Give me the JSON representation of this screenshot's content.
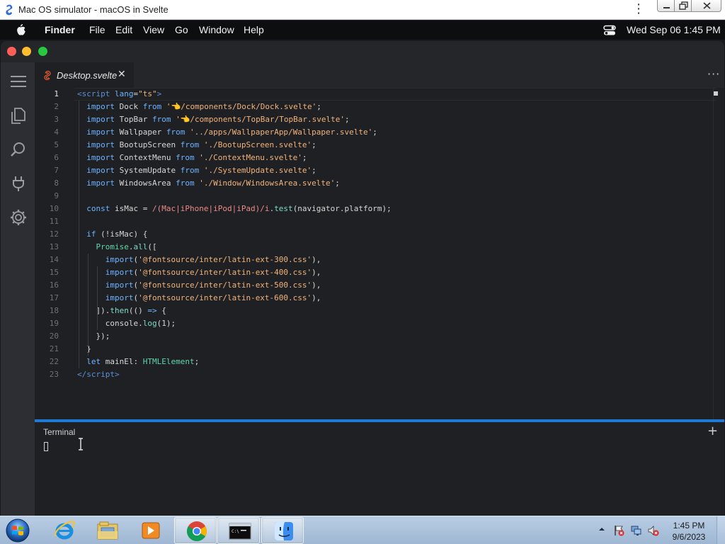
{
  "browser": {
    "title": "Mac OS simulator - macOS in Svelte",
    "kebab": "⋮"
  },
  "menubar": {
    "app_name": "Finder",
    "items": [
      "File",
      "Edit",
      "View",
      "Go",
      "Window",
      "Help"
    ],
    "datetime": "Wed Sep 06  1:45 PM"
  },
  "editor": {
    "tab": {
      "label": "Desktop.svelte",
      "close": "✕"
    },
    "more": "···",
    "active_line": 1,
    "lines": [
      {
        "n": "1",
        "html": "<span class=\"tag\">&lt;</span><span class=\"tag\">script</span> <span class=\"kw\">lang</span>=<span class=\"str\">\"ts\"</span><span class=\"tag\">&gt;</span>"
      },
      {
        "n": "2",
        "html": "  <span class=\"kw\">import</span> Dock <span class=\"kw\">from</span> <span class=\"str\">'👈/components/Dock/Dock.svelte'</span>;"
      },
      {
        "n": "3",
        "html": "  <span class=\"kw\">import</span> TopBar <span class=\"kw\">from</span> <span class=\"str\">'👈/components/TopBar/TopBar.svelte'</span>;"
      },
      {
        "n": "4",
        "html": "  <span class=\"kw\">import</span> Wallpaper <span class=\"kw\">from</span> <span class=\"str\">'../apps/WallpaperApp/Wallpaper.svelte'</span>;"
      },
      {
        "n": "5",
        "html": "  <span class=\"kw\">import</span> BootupScreen <span class=\"kw\">from</span> <span class=\"str\">'./BootupScreen.svelte'</span>;"
      },
      {
        "n": "6",
        "html": "  <span class=\"kw\">import</span> ContextMenu <span class=\"kw\">from</span> <span class=\"str\">'./ContextMenu.svelte'</span>;"
      },
      {
        "n": "7",
        "html": "  <span class=\"kw\">import</span> SystemUpdate <span class=\"kw\">from</span> <span class=\"str\">'./SystemUpdate.svelte'</span>;"
      },
      {
        "n": "8",
        "html": "  <span class=\"kw\">import</span> WindowsArea <span class=\"kw\">from</span> <span class=\"str\">'./Window/WindowsArea.svelte'</span>;"
      },
      {
        "n": "9",
        "html": ""
      },
      {
        "n": "10",
        "html": "  <span class=\"kw\">const</span> isMac = <span class=\"rx\">/(Mac|iPhone|iPod|iPad)/i</span>.<span class=\"fn\">test</span>(navigator.platform);"
      },
      {
        "n": "11",
        "html": ""
      },
      {
        "n": "12",
        "html": "  <span class=\"kw\">if</span> (!isMac) {"
      },
      {
        "n": "13",
        "html": "    <span class=\"cls\">Promise</span>.<span class=\"fn\">all</span>(["
      },
      {
        "n": "14",
        "html": "      <span class=\"kw\">import</span>(<span class=\"str\">'@fontsource/inter/latin-ext-300.css'</span>),"
      },
      {
        "n": "15",
        "html": "      <span class=\"kw\">import</span>(<span class=\"str\">'@fontsource/inter/latin-ext-400.css'</span>),"
      },
      {
        "n": "16",
        "html": "      <span class=\"kw\">import</span>(<span class=\"str\">'@fontsource/inter/latin-ext-500.css'</span>),"
      },
      {
        "n": "17",
        "html": "      <span class=\"kw\">import</span>(<span class=\"str\">'@fontsource/inter/latin-ext-600.css'</span>),"
      },
      {
        "n": "18",
        "html": "    ]).<span class=\"fn\">then</span>(() <span class=\"kw\">=&gt;</span> {"
      },
      {
        "n": "19",
        "html": "      console.<span class=\"fn\">log</span>(1);"
      },
      {
        "n": "20",
        "html": "    });"
      },
      {
        "n": "21",
        "html": "  }"
      },
      {
        "n": "22",
        "html": "  <span class=\"kw\">let</span> mainEl: <span class=\"cls\">HTMLElement</span>;"
      },
      {
        "n": "23",
        "html": "<span class=\"tag\">&lt;/script&gt;</span>"
      }
    ]
  },
  "terminal": {
    "title": "Terminal",
    "add": "+"
  },
  "taskbar": {
    "clock_time": "1:45 PM",
    "clock_date": "9/6/2023"
  },
  "colors": {
    "accent": "#1e7ad8",
    "traffic_close": "#ff5f57",
    "traffic_min": "#febc2e",
    "traffic_max": "#28c840"
  }
}
